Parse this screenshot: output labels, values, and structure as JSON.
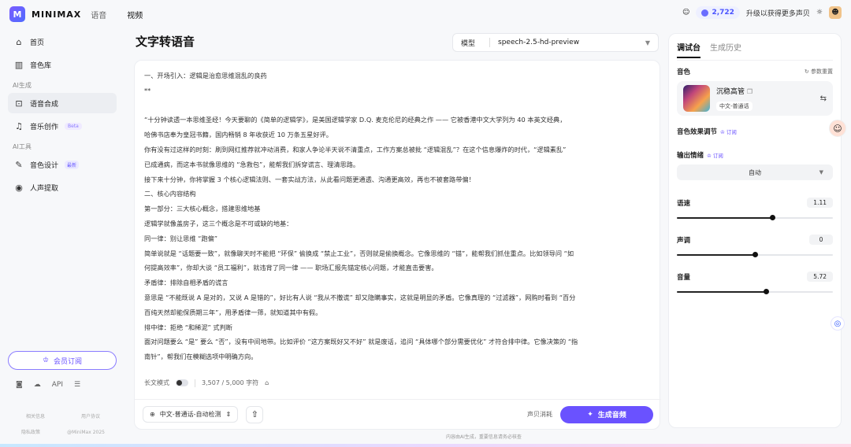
{
  "brand": {
    "name": "MINIMAX",
    "logo": "M"
  },
  "topnav": [
    "语音",
    "视频"
  ],
  "topright": {
    "credits": "2,722",
    "upgrade": "升级以获得更多声贝"
  },
  "sidebar": {
    "items": [
      {
        "label": "首页",
        "icon": "home-icon"
      },
      {
        "label": "音色库",
        "icon": "library-icon"
      }
    ],
    "section_ai_gen": "AI生成",
    "gen_items": [
      {
        "label": "语音合成",
        "icon": "tts-icon"
      },
      {
        "label": "音乐创作",
        "icon": "music-icon",
        "badge": "Beta"
      }
    ],
    "section_ai_tools": "AI工具",
    "tool_items": [
      {
        "label": "音色设计",
        "icon": "voice-design-icon",
        "badge": "最新"
      },
      {
        "label": "人声提取",
        "icon": "vocal-extract-icon"
      }
    ],
    "vip_label": "会员订阅",
    "icons": [
      "discord-icon",
      "wechat-icon",
      "API",
      "collapse-icon"
    ],
    "footer": {
      "related": "相关信息",
      "agreement": "用户协议",
      "privacy": "隐私政策",
      "copyright": "@MiniMax 2025"
    }
  },
  "main": {
    "title": "文字转语音",
    "model_label": "模型",
    "model_value": "speech-2.5-hd-preview",
    "lines": [
      "一、开场引入：逻辑是治愈思维混乱的良药",
      "**",
      "",
      "“十分钟读透一本思维圣经！今天要聊的《简单的逻辑学》，是美国逻辑学家 D.Q. 麦克伦尼的经典之作 —— 它被香港中文大学列为 40 本英文经典，",
      "哈佛书店奉为皇冠书籍，国内畅销 8 年收获近 10 万条五星好评。",
      "你有没有过这样的时刻：刷到网红推荐就冲动消费，和家人争论半天说不清重点，工作方案总被批 “逻辑混乱”？在这个信息爆炸的时代，“逻辑素乱”",
      "已成通病，而这本书就像思维的 “急救包”，能帮我们拆穿谎言、理清思路。",
      "接下来十分钟，你将掌握 3 个核心逻辑法则、一套实战方法，从此看问题更通透、沟通更高效，再也不被套路带偏！",
      "二、核心内容结构",
      "第一部分：三大核心概念，搭建思维地基",
      "逻辑学就像盖房子，这三个概念是不可或缺的地基：",
      "同一律：别让思维 “跑偏”",
      "简单说就是 “话题要一致”，就像聊天时不能把 “环保” 偷换成 “禁止工业”，否则就是偷换概念。它像思维的 “锚”，能帮我们抓住重点。比如领导问 “如",
      "何提高效率”，你却大谈 “员工福利”，就违背了同一律 —— 职场汇报先锚定核心问题，才能直击要害。",
      "矛盾律：排除自相矛盾的谎言",
      "意思是 “不能既说 A 是对的，又说 A 是错的”，好比有人说 “我从不撒谎” 却又隐瞒事实，这就是明显的矛盾。它像真理的 “过滤器”，网购时看到 “百分",
      "百纯天然却能保质期三年”，用矛盾律一筛，就知道其中有假。",
      "排中律：拒绝 “和稀泥” 式判断",
      "面对问题要么 “是” 要么 “否”，没有中间地带。比如评价 “这方案既好又不好” 就是废话，追问 “具体哪个部分需要优化” 才符合排中律。它像决策的 “指",
      "南针”，帮我们在模糊选项中明确方向。"
    ],
    "long_mode": "长文模式",
    "char_count": "3,507 / 5,000 字符",
    "lang": "中文-普通话-自动检测",
    "consume": "声贝消耗",
    "generate": "生成音频",
    "footnote": "内容由AI生成，重要信息请务必核查"
  },
  "panel": {
    "tab_active": "调试台",
    "tab_other": "生成历史",
    "voice_label": "音色",
    "reset": "参数重置",
    "voice_name": "沉稳高管",
    "voice_tag": "中文-普通话",
    "effect_label": "音色效果调节",
    "vip_tag": "订阅",
    "emotion_label": "输出情绪",
    "emotion_value": "自动",
    "speed_label": "语速",
    "speed_value": "1.11",
    "speed_frac": 0.61,
    "pitch_label": "声调",
    "pitch_value": "0",
    "pitch_frac": 0.5,
    "volume_label": "音量",
    "volume_value": "5.72",
    "volume_frac": 0.57
  }
}
